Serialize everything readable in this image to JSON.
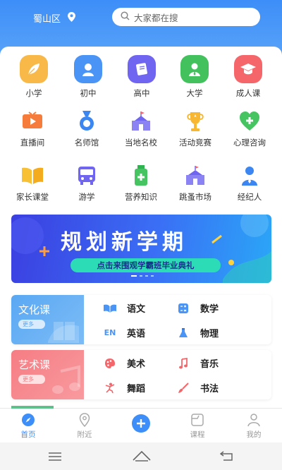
{
  "header": {
    "location": "蜀山区",
    "search_placeholder": "大家都在搜"
  },
  "main_grid": [
    {
      "label": "小学",
      "color": "#f9b949"
    },
    {
      "label": "初中",
      "color": "#4a94f5"
    },
    {
      "label": "高中",
      "color": "#7065f0"
    },
    {
      "label": "大学",
      "color": "#43c15d"
    },
    {
      "label": "成人课",
      "color": "#f5666b"
    }
  ],
  "service_row1": [
    {
      "label": "直播间",
      "icon": "tv-icon"
    },
    {
      "label": "名师馆",
      "icon": "medal-icon"
    },
    {
      "label": "当地名校",
      "icon": "school-icon"
    },
    {
      "label": "活动竞赛",
      "icon": "trophy-icon"
    },
    {
      "label": "心理咨询",
      "icon": "heart-icon"
    }
  ],
  "service_row2": [
    {
      "label": "家长课堂",
      "icon": "book-icon"
    },
    {
      "label": "游学",
      "icon": "bus-icon"
    },
    {
      "label": "营养知识",
      "icon": "bottle-icon"
    },
    {
      "label": "跳蚤市场",
      "icon": "market-icon"
    },
    {
      "label": "经纪人",
      "icon": "agent-icon"
    }
  ],
  "banner": {
    "title": "规划新学期",
    "subtitle": "点击来围观学霸班毕业典礼"
  },
  "culture": {
    "title": "文化课",
    "more": "更多",
    "items": [
      {
        "label": "语文",
        "icon": "open-book-icon",
        "glyph": ""
      },
      {
        "label": "数学",
        "icon": "calculator-icon",
        "glyph": ""
      },
      {
        "label": "英语",
        "icon": "en-icon",
        "glyph": "EN"
      },
      {
        "label": "物理",
        "icon": "flask-icon",
        "glyph": ""
      }
    ]
  },
  "art": {
    "title": "艺术课",
    "more": "更多",
    "items": [
      {
        "label": "美术",
        "icon": "palette-icon"
      },
      {
        "label": "音乐",
        "icon": "music-note-icon"
      },
      {
        "label": "舞蹈",
        "icon": "dancer-icon"
      },
      {
        "label": "书法",
        "icon": "brush-icon"
      }
    ]
  },
  "tabs": [
    {
      "label": "首页",
      "active": true
    },
    {
      "label": "附近",
      "active": false
    },
    {
      "label": "",
      "active": false
    },
    {
      "label": "课程",
      "active": false
    },
    {
      "label": "我的",
      "active": false
    }
  ],
  "colors": {
    "primary": "#3d8ef8",
    "culture": "#5aa8f3",
    "art": "#f57d83"
  }
}
